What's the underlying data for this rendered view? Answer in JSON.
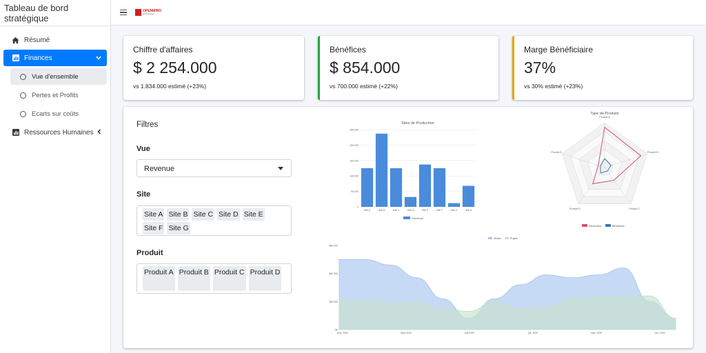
{
  "app": {
    "title": "Tableau de bord stratégique"
  },
  "logo": {
    "line1": "OPENMIND",
    "line2": "technologies"
  },
  "sidebar": {
    "items": [
      {
        "label": "Résumé",
        "icon": "home-icon"
      },
      {
        "label": "Finances",
        "icon": "chart-icon",
        "active": true
      },
      {
        "label": "Ressources Humaines",
        "icon": "chart-icon"
      }
    ],
    "finances_sub": [
      {
        "label": "Vue d'ensemble",
        "active": true
      },
      {
        "label": "Pertes et Profits"
      },
      {
        "label": "Ecarts sur coûts"
      }
    ]
  },
  "kpis": [
    {
      "title": "Chiffre d'affaires",
      "value": "$ 2 254.000",
      "sub": "vs 1.834.000 estimé (+23%)",
      "accent": "#ffffff"
    },
    {
      "title": "Bénéfices",
      "value": "$ 854.000",
      "sub": "vs 700.000 estimé (+22%)",
      "accent": "#28a745"
    },
    {
      "title": "Marge Bénéficiaire",
      "value": "37%",
      "sub": "vs 30% estimé (+23%)",
      "accent": "#e0a800"
    }
  ],
  "filters": {
    "title": "Filtres",
    "vue_label": "Vue",
    "vue_value": "Revenue",
    "site_label": "Site",
    "sites": [
      "Site A",
      "Site B",
      "Site C",
      "Site D",
      "Site E",
      "Site F",
      "Site G"
    ],
    "produit_label": "Produit",
    "produits": [
      "Produit A",
      "Produit B",
      "Produit C",
      "Produit D"
    ]
  },
  "chart_data": [
    {
      "type": "bar",
      "title": "Sites de Production",
      "categories": [
        "Site A",
        "Site B",
        "Site C",
        "Site D",
        "Site E",
        "Site F",
        "Site G",
        "Site H"
      ],
      "series": [
        {
          "name": "Revenue",
          "values": [
            125000,
            237000,
            125000,
            32000,
            137000,
            125000,
            12000,
            68000
          ]
        }
      ],
      "yticks": [
        "0",
        "50,000",
        "100,000",
        "150,000",
        "200,000",
        "250,000"
      ],
      "ylim": [
        0,
        250000
      ],
      "legend": "bottom",
      "color": "#4a8bdc"
    },
    {
      "type": "radar",
      "title": "Type de Produits",
      "categories": [
        "Produit A",
        "Produit B",
        "Produit C",
        "Produit D",
        "Produit E"
      ],
      "series": [
        {
          "name": "Revenues",
          "values": [
            0.9,
            0.85,
            0.35,
            0.45,
            0.15
          ],
          "color": "#d9506a"
        },
        {
          "name": "Bénéfices",
          "values": [
            0.2,
            0.15,
            0.1,
            0.15,
            0.1
          ],
          "color": "#3e79b5"
        }
      ],
      "legend": "bottom"
    },
    {
      "type": "area",
      "x": [
        "janv. 2020",
        "mars 2020",
        "mai 2020",
        "juil. 2020",
        "sept. 2020",
        "nov. 2020"
      ],
      "yticks": [
        "$0",
        "$20 000",
        "$40 000",
        "$60 000"
      ],
      "ylim": [
        0,
        60000
      ],
      "series": [
        {
          "name": "Ventes",
          "color": "#a8c4f0",
          "values": [
            50000,
            50000,
            46000,
            37000,
            22000,
            8000,
            22000,
            32000,
            39000,
            37000,
            39000,
            44000,
            20000,
            8000
          ]
        },
        {
          "name": "Projets",
          "color": "#c8e0cc",
          "values": [
            21000,
            21000,
            19000,
            20000,
            15000,
            13000,
            20000,
            15000,
            16000,
            22000,
            24000,
            24000,
            24000,
            8000
          ]
        }
      ],
      "legend": "top"
    }
  ]
}
